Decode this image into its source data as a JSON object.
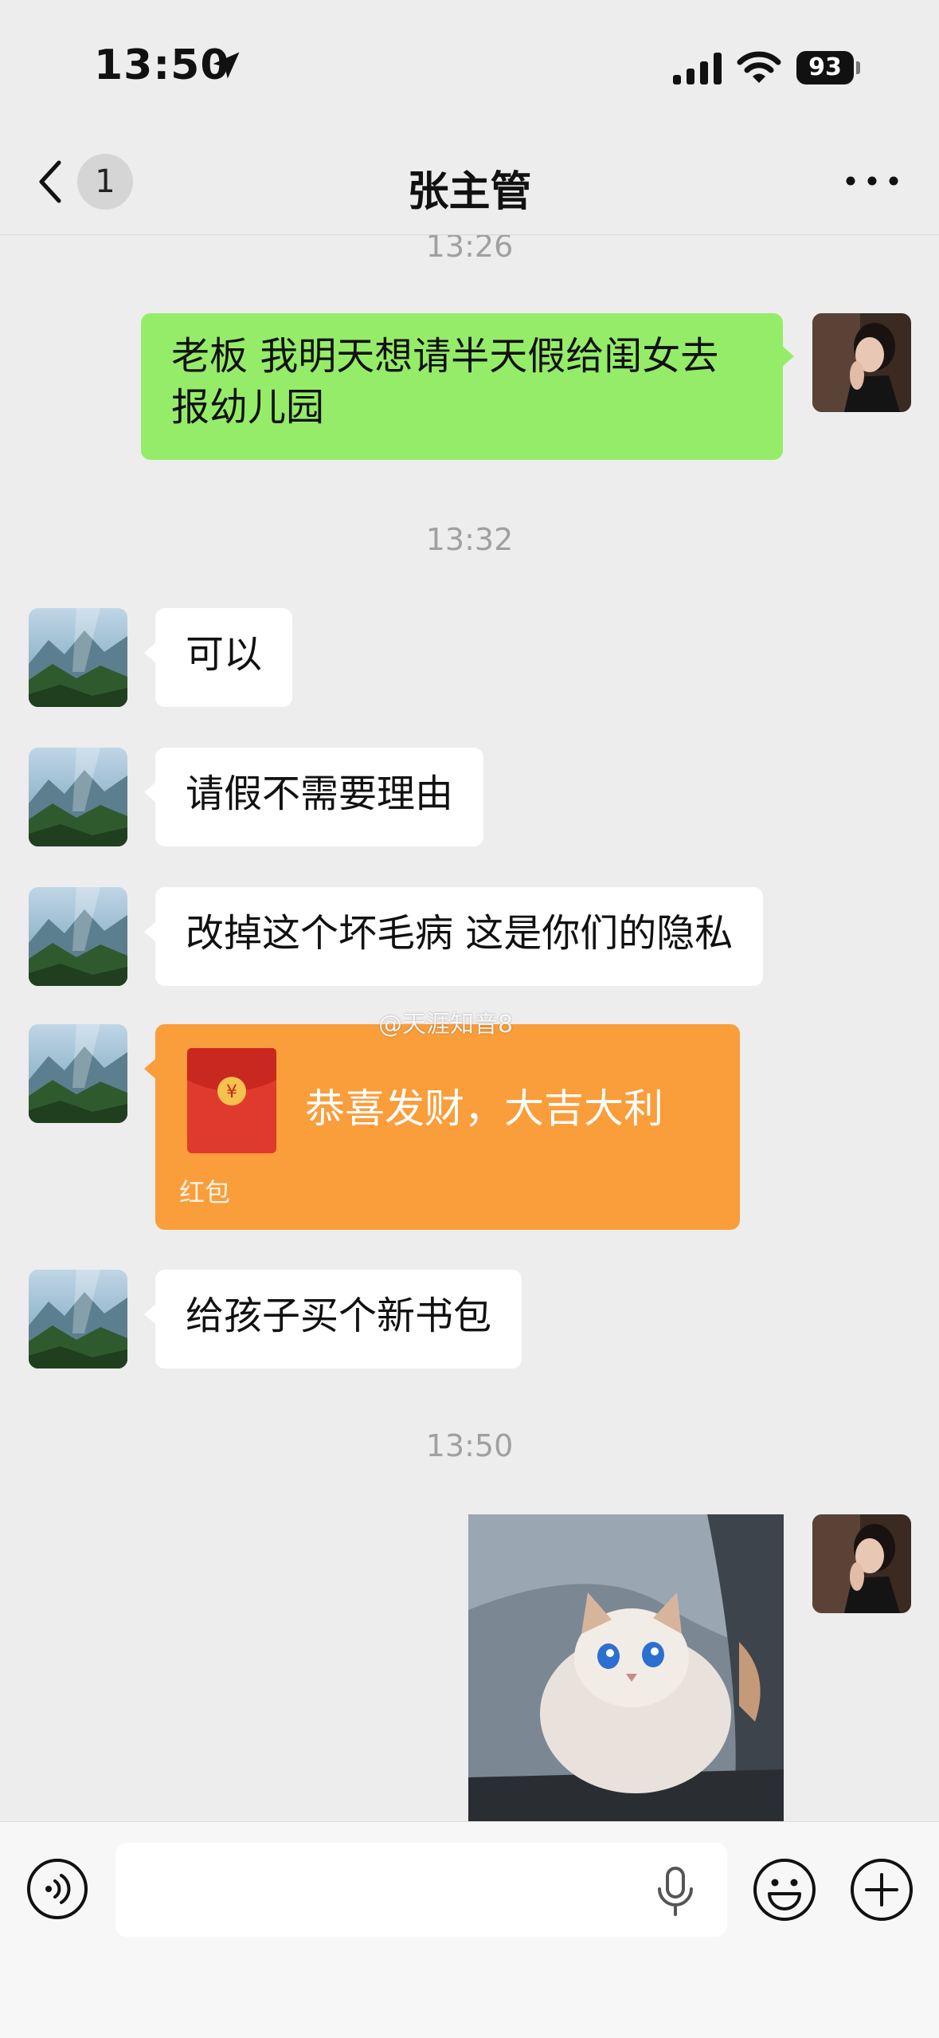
{
  "status_bar": {
    "time": "13:50",
    "battery": "93"
  },
  "nav": {
    "unread_count": "1",
    "title": "张主管"
  },
  "messages": [
    {
      "type": "timestamp",
      "text": "13:26"
    },
    {
      "type": "text",
      "direction": "out",
      "text": "老板  我明天想请半天假给闺女去报幼儿园"
    },
    {
      "type": "timestamp",
      "text": "13:32"
    },
    {
      "type": "text",
      "direction": "in",
      "text": "可以"
    },
    {
      "type": "text",
      "direction": "in",
      "text": "请假不需要理由"
    },
    {
      "type": "text",
      "direction": "in",
      "text": "改掉这个坏毛病  这是你们的隐私"
    },
    {
      "type": "red_packet",
      "direction": "in",
      "text": "恭喜发财，大吉大利",
      "label": "红包",
      "currency_symbol": "¥"
    },
    {
      "type": "text",
      "direction": "in",
      "text": "给孩子买个新书包"
    },
    {
      "type": "timestamp",
      "text": "13:50"
    },
    {
      "type": "image",
      "direction": "out",
      "description": "crying-cat-sticker"
    }
  ],
  "watermark": "@天涯知音8",
  "input": {
    "placeholder": ""
  },
  "colors": {
    "outgoing_bubble": "#95ec69",
    "incoming_bubble": "#ffffff",
    "red_packet": "#fa9d3b",
    "background": "#ededed"
  }
}
